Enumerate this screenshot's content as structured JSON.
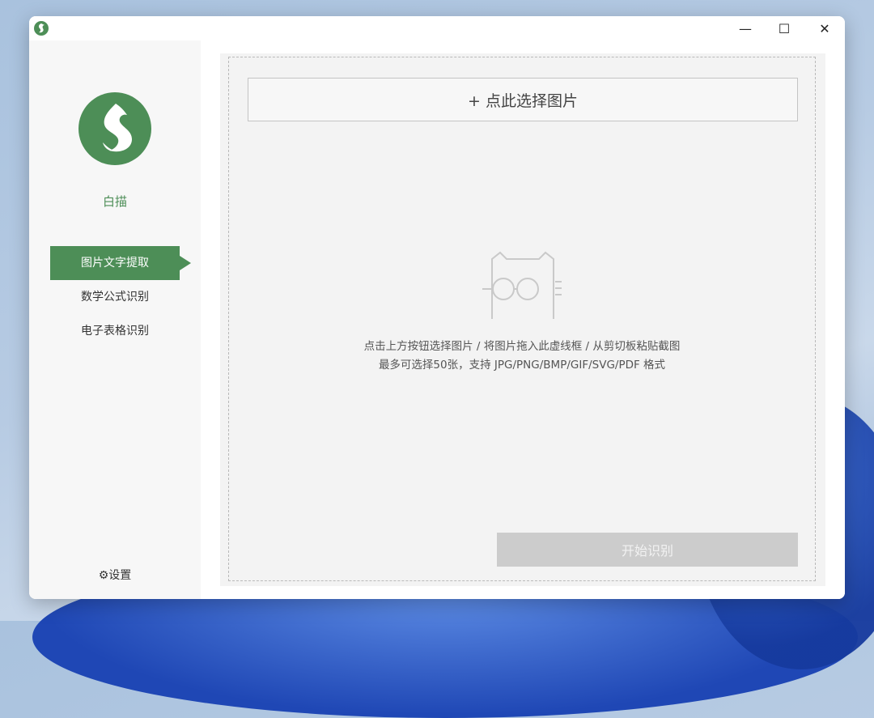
{
  "app": {
    "name": "白描",
    "brand_color": "#4d8e57"
  },
  "window_controls": {
    "minimize": "—",
    "maximize": "☐",
    "close": "✕"
  },
  "sidebar": {
    "items": [
      {
        "label": "图片文字提取",
        "active": true
      },
      {
        "label": "数学公式识别",
        "active": false
      },
      {
        "label": "电子表格识别",
        "active": false
      }
    ],
    "settings_label": "⚙设置"
  },
  "main": {
    "select_button_label": "+ 点此选择图片",
    "hint_line1": "点击上方按钮选择图片 / 将图片拖入此虚线框 / 从剪切板粘贴截图",
    "hint_line2": "最多可选择50张，支持 JPG/PNG/BMP/GIF/SVG/PDF 格式",
    "start_button_label": "开始识别",
    "illustration_icon": "cat-with-glasses-icon"
  }
}
